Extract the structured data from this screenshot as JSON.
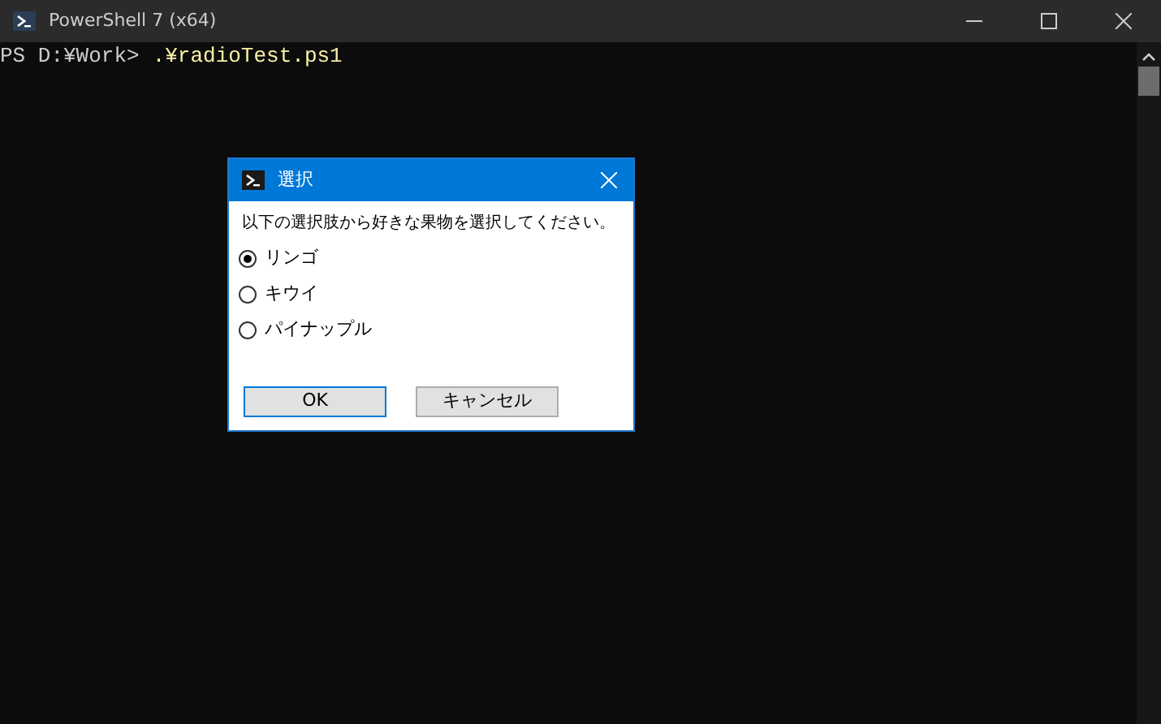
{
  "window": {
    "title": "PowerShell 7 (x64)"
  },
  "console": {
    "prompt": "PS D:¥Work>",
    "command": ".¥radioTest.ps1"
  },
  "dialog": {
    "title": "選択",
    "message": "以下の選択肢から好きな果物を選択してください。",
    "options": [
      {
        "label": "リンゴ",
        "selected": true
      },
      {
        "label": "キウイ",
        "selected": false
      },
      {
        "label": "パイナップル",
        "selected": false
      }
    ],
    "buttons": [
      {
        "label": "OK",
        "default": true
      },
      {
        "label": "キャンセル",
        "default": false
      }
    ]
  }
}
